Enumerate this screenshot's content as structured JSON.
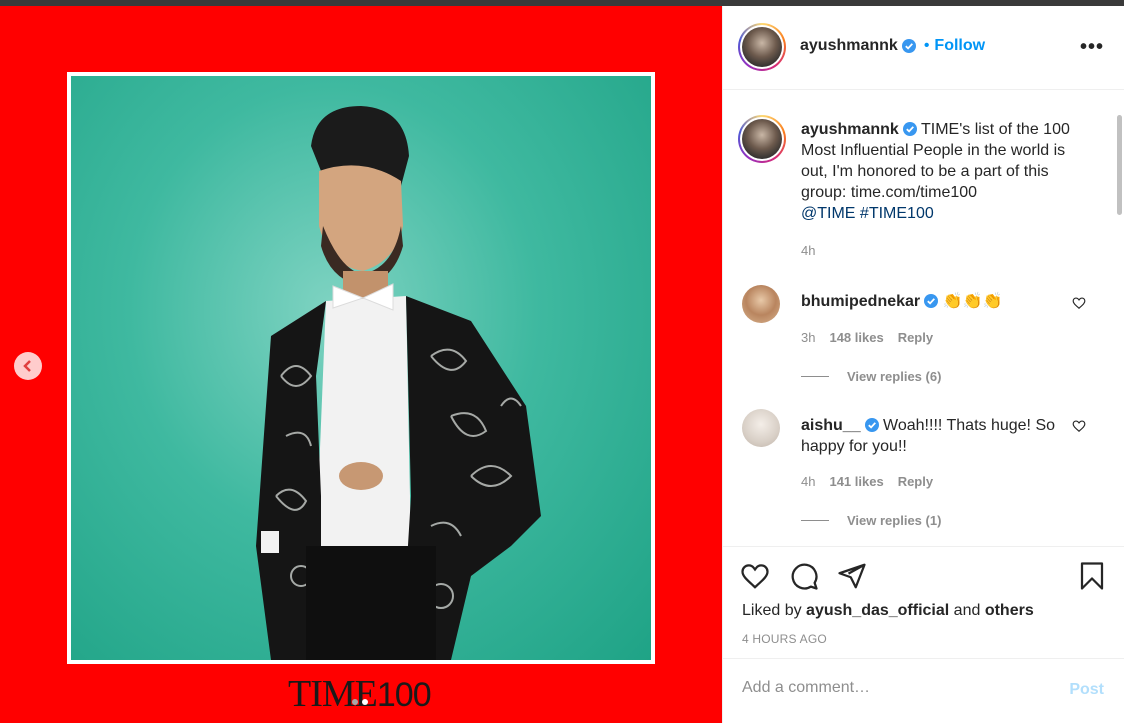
{
  "post": {
    "author": "ayushmannk",
    "follow_label": "Follow",
    "follow_separator": "•",
    "more_label": "•••",
    "image_overlay_brand": "TIME",
    "image_overlay_number": "100"
  },
  "caption": {
    "username": "ayushmannk",
    "text": "TIME's list of the 100 Most Influential People in the world is out, I'm honored to be a part of this group: time.com/time100",
    "mention": "@TIME",
    "hashtag": "#TIME100",
    "age": "4h"
  },
  "comments": [
    {
      "username": "bhumipednekar",
      "text": "👏👏👏",
      "age": "3h",
      "likes": "148 likes",
      "reply_label": "Reply",
      "view_replies": "View replies (6)"
    },
    {
      "username": "aishu__",
      "text": "Woah!!!! Thats huge! So happy for you!!",
      "age": "4h",
      "likes": "141 likes",
      "reply_label": "Reply",
      "view_replies": "View replies (1)"
    }
  ],
  "engagement": {
    "liked_by_prefix": "Liked by",
    "liked_by_user": "ayush_das_official",
    "liked_by_and": "and",
    "liked_by_others": "others",
    "timestamp": "4 HOURS AGO"
  },
  "add_comment": {
    "placeholder": "Add a comment…",
    "post_label": "Post"
  },
  "colors": {
    "media_background": "#ff0000",
    "accent": "#0095f6",
    "verified": "#3897f0"
  },
  "icons": [
    "chevron-left-icon",
    "verified-badge-icon",
    "heart-icon",
    "comment-icon",
    "share-icon",
    "bookmark-icon",
    "more-icon"
  ],
  "carousel": {
    "slide_count": 2,
    "active_index": 1
  }
}
